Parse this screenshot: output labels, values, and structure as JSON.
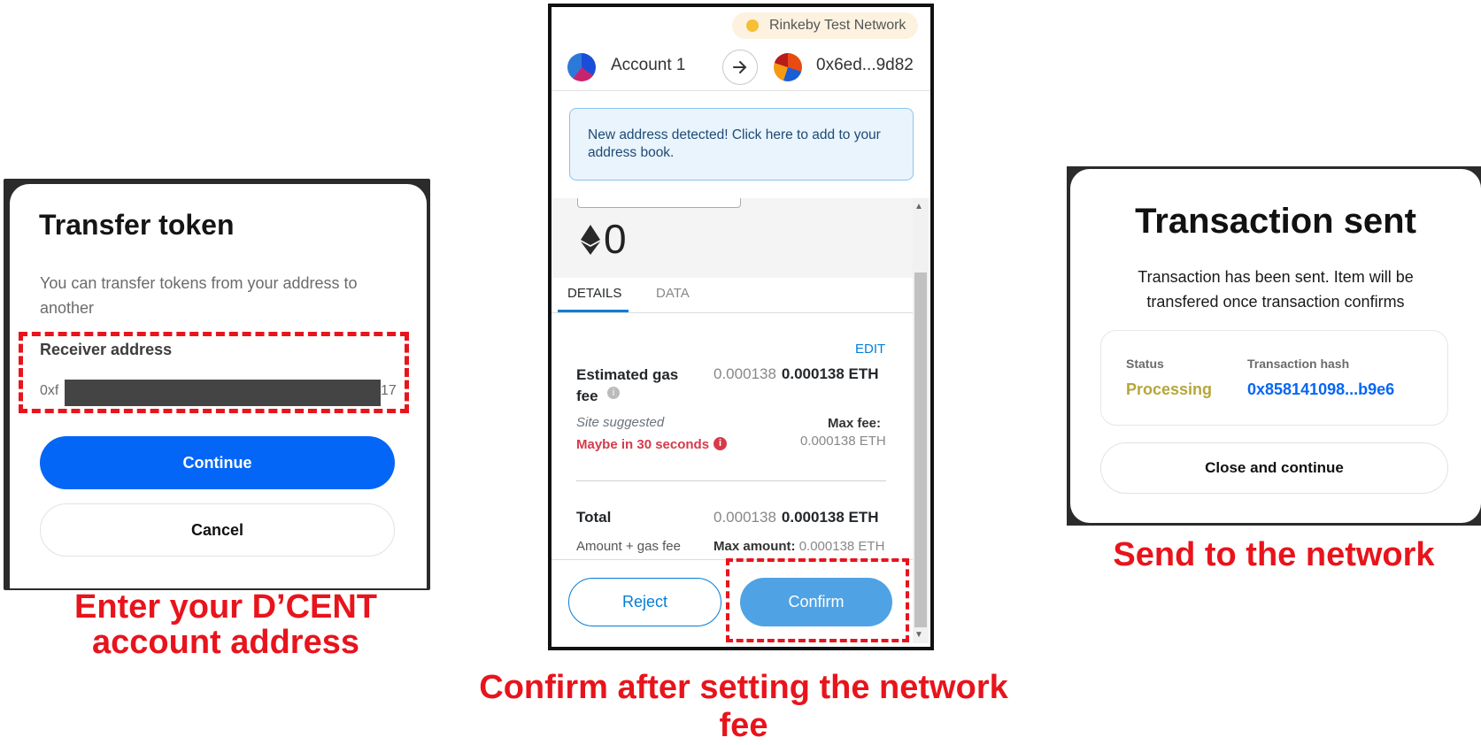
{
  "transfer_panel": {
    "title": "Transfer token",
    "description": "You can transfer tokens from your address to another",
    "receiver_label": "Receiver address",
    "address_prefix": "0xf",
    "address_suffix": "17",
    "continue_label": "Continue",
    "cancel_label": "Cancel",
    "caption": "Enter your D’CENT account address"
  },
  "confirm_panel": {
    "network": "Rinkeby Test Network",
    "from_account": "Account 1",
    "to_account": "0x6ed...9d82",
    "alert": "New address detected! Click here to add to your address book.",
    "amount": "0",
    "tabs": [
      "DETAILS",
      "DATA"
    ],
    "edit_label": "EDIT",
    "gas_fee_label": "Estimated gas fee",
    "gas_fee_secondary": "0.000138",
    "gas_fee_primary": "0.000138 ETH",
    "site_suggested": "Site suggested",
    "maybe_time": "Maybe in 30 seconds",
    "max_fee_label": "Max fee:",
    "max_fee_value": "0.000138 ETH",
    "total_label": "Total",
    "total_secondary": "0.000138",
    "total_primary": "0.000138 ETH",
    "amount_gas_label": "Amount + gas fee",
    "max_amount_label": "Max amount:",
    "max_amount_value": "0.000138 ETH",
    "reject_label": "Reject",
    "confirm_label": "Confirm",
    "caption": "Confirm after setting the network fee"
  },
  "sent_panel": {
    "title": "Transaction sent",
    "description": "Transaction has been sent. Item will be transfered once transaction confirms",
    "status_label": "Status",
    "status_value": "Processing",
    "hash_label": "Transaction hash",
    "hash_value": "0x858141098...b9e6",
    "close_label": "Close and continue",
    "caption": "Send to the network"
  },
  "colors": {
    "highlight_red": "#e8141c",
    "primary_blue": "#0466f6",
    "metamask_blue": "#037dd6",
    "processing_olive": "#b7a63a"
  }
}
